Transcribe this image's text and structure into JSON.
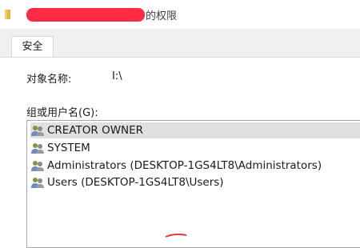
{
  "window": {
    "title_suffix": "的权限"
  },
  "tabs": [
    {
      "label": "安全"
    }
  ],
  "object_name": {
    "label": "对象名称:",
    "value": "I:\\"
  },
  "groups": {
    "label": "组或用户名(G):",
    "items": [
      {
        "name": "CREATOR OWNER",
        "selected": true,
        "icon": "users-icon"
      },
      {
        "name": "SYSTEM",
        "selected": false,
        "icon": "users-icon"
      },
      {
        "name": "Administrators (DESKTOP-1GS4LT8\\Administrators)",
        "selected": false,
        "icon": "users-icon"
      },
      {
        "name": "Users (DESKTOP-1GS4LT8\\Users)",
        "selected": false,
        "icon": "users-icon"
      }
    ]
  },
  "colors": {
    "redaction": "#ff2a45",
    "selection": "#e0e0e0",
    "tab_strip": "#f0f0f0"
  }
}
